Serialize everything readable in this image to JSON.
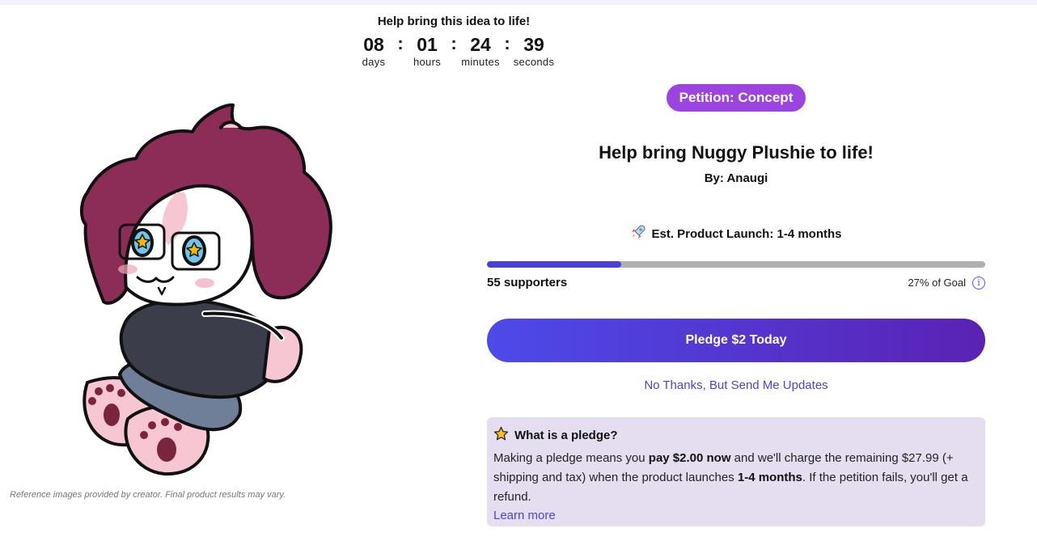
{
  "countdown": {
    "title": "Help bring this idea to life!",
    "days": "08",
    "days_label": "days",
    "hours": "01",
    "hours_label": "hours",
    "minutes": "24",
    "minutes_label": "minutes",
    "seconds": "39",
    "seconds_label": "seconds",
    "separator": ":"
  },
  "disclaimer": "Reference images provided by creator. Final product results may vary.",
  "badge": "Petition: Concept",
  "title": "Help bring Nuggy Plushie to life!",
  "byline": "By: Anaugi",
  "launch": "Est. Product Launch: 1-4 months",
  "progress": {
    "fraction": 0.27,
    "supporters": "55 supporters",
    "goal_text": "27% of Goal",
    "info_glyph": "i"
  },
  "pledge_button": "Pledge $2 Today",
  "no_thanks_link": "No Thanks, But Send Me Updates",
  "info_box": {
    "title": "What is a pledge?",
    "t1": "Making a pledge means you ",
    "b1": "pay $2.00 now",
    "t2": " and we'll charge the remaining $27.99 (+ shipping and tax) when the product launches ",
    "b2": "1-4 months",
    "t3": ". If the petition fails, you'll get a refund.",
    "learn_more": "Learn more"
  },
  "icons": {
    "launch": "rocket-icon",
    "pledge_info": "star-icon",
    "goal_info": "info-icon"
  },
  "colors": {
    "brand_purple": "#4d4aea",
    "badge_purple": "#9b44e0",
    "info_bg": "#e4def0",
    "link": "#4a44d8"
  }
}
